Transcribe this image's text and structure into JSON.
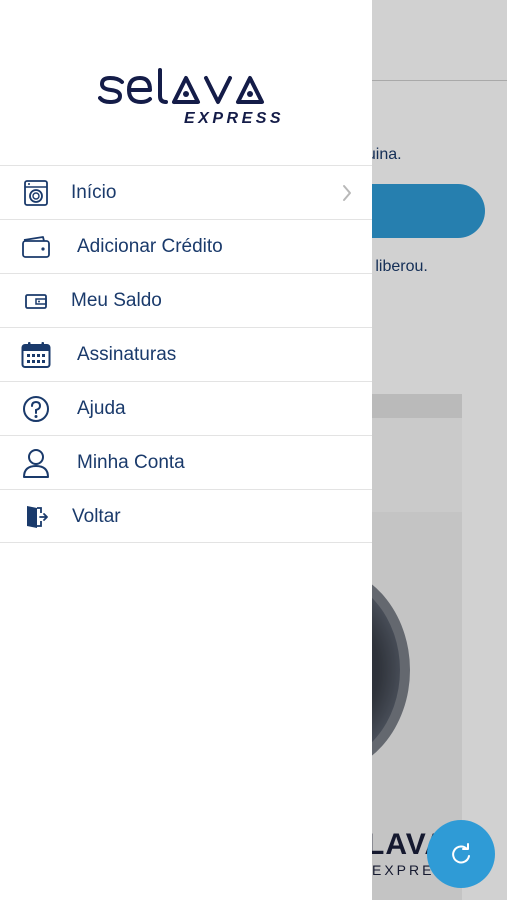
{
  "background": {
    "text_line1": "quina.",
    "text_line2": "cê liberou.",
    "machine_logo": "LAVA",
    "machine_logo_sub": "EXPRESS"
  },
  "drawer": {
    "brand": {
      "logo": "selava",
      "subtitle": "EXPRESS"
    },
    "items": [
      {
        "label": "Início",
        "icon": "washing-machine-icon"
      },
      {
        "label": "Adicionar Crédito",
        "icon": "wallet-icon"
      },
      {
        "label": "Meu Saldo",
        "icon": "wallet-small-icon"
      },
      {
        "label": "Assinaturas",
        "icon": "calendar-icon"
      },
      {
        "label": "Ajuda",
        "icon": "help-icon"
      },
      {
        "label": "Minha Conta",
        "icon": "user-icon"
      },
      {
        "label": "Voltar",
        "icon": "exit-door-icon"
      }
    ]
  },
  "colors": {
    "primary_text": "#1a3a6b",
    "brand_navy": "#141c48",
    "accent_blue": "#2f9bd6"
  }
}
